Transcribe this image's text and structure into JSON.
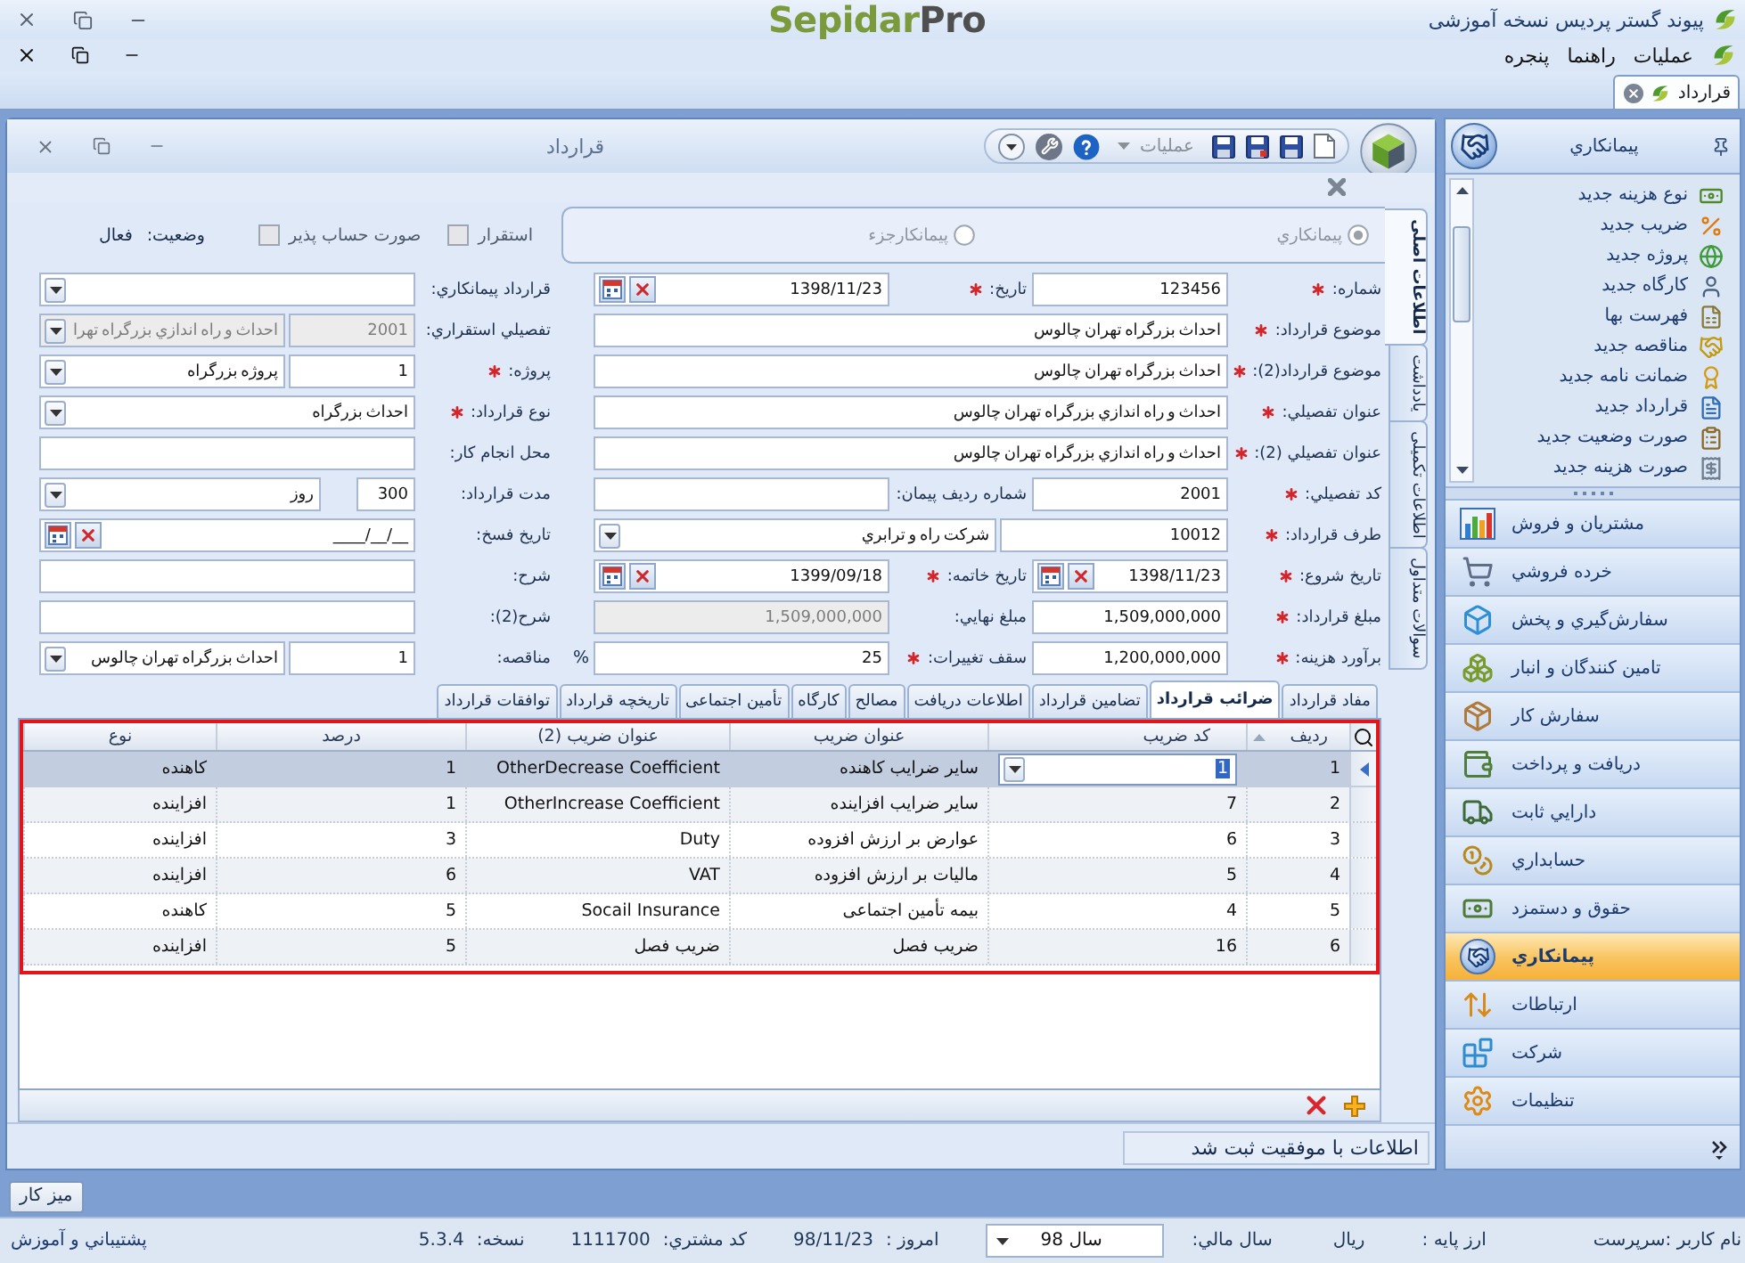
{
  "app_window": {
    "title": "پیوند گستر پردیس نسخه آموزشی",
    "logo": {
      "name": "Sepidar",
      "edition": "Pro"
    }
  },
  "menu": [
    {
      "label": "عملیات"
    },
    {
      "label": "راهنما"
    },
    {
      "label": "پنجره"
    }
  ],
  "document_tabs": [
    {
      "label": "قرارداد",
      "selected": true
    }
  ],
  "nav_panel": {
    "title": "پیمانکاري",
    "shortcuts": [
      {
        "label": "نوع هزینه جدید"
      },
      {
        "label": "ضریب جدید"
      },
      {
        "label": "پروژه جدید"
      },
      {
        "label": "کارگاه جدید"
      },
      {
        "label": "فهرست بها"
      },
      {
        "label": "مناقصه جدید"
      },
      {
        "label": "ضمانت نامه جدید"
      },
      {
        "label": "قرارداد جدید"
      },
      {
        "label": "صورت وضعیت جدید"
      },
      {
        "label": "صورت هزینه جدید"
      }
    ],
    "modules": [
      {
        "label": "مشتریان و فروش",
        "selected": false
      },
      {
        "label": "خرده فروشي",
        "selected": false
      },
      {
        "label": "سفارش‌گیري و پخش",
        "selected": false
      },
      {
        "label": "تامین کنندگان و انبار",
        "selected": false
      },
      {
        "label": "سفارش کار",
        "selected": false
      },
      {
        "label": "دریافت و پرداخت",
        "selected": false
      },
      {
        "label": "دارایي ثابت",
        "selected": false
      },
      {
        "label": "حسابداري",
        "selected": false
      },
      {
        "label": "حقوق و دستمزد",
        "selected": false
      },
      {
        "label": "پیمانکاري",
        "selected": true
      },
      {
        "label": "ارتباطات",
        "selected": false
      },
      {
        "label": "شرکت",
        "selected": false
      },
      {
        "label": "تنظیمات",
        "selected": false
      }
    ]
  },
  "document_window": {
    "title": "قرارداد",
    "operations_menu": "عملیات"
  },
  "form": {
    "side_tabs": [
      {
        "label": "اطلاعات اصلی",
        "selected": true
      },
      {
        "label": "یادداشت",
        "selected": false
      },
      {
        "label": "اطلاعات تکمیلی",
        "selected": false
      },
      {
        "label": "سوالات متداول",
        "selected": false
      }
    ],
    "contractor_type": [
      {
        "label": "پیمانکاري",
        "selected": true,
        "disabled": true
      },
      {
        "label": "پیمانکارجزء",
        "selected": false,
        "disabled": true
      }
    ],
    "options": [
      {
        "label": "استقرار",
        "checked": false,
        "disabled": true
      },
      {
        "label": "صورت حساب پذیر",
        "checked": false,
        "disabled": true
      }
    ],
    "status": {
      "label": "وضعیت:",
      "value": "فعال"
    },
    "rows": [
      [
        {
          "label": "شماره:",
          "required": true,
          "fields": [
            {
              "kind": "text",
              "value": "123456",
              "disabled": false
            }
          ]
        },
        {
          "label": "تاریخ:",
          "required": true,
          "fields": [
            {
              "kind": "date",
              "value": "1398/11/23",
              "disabled": false
            }
          ]
        },
        {
          "label": "قرارداد پیمانکاري:",
          "required": false,
          "fields": [
            {
              "kind": "combo",
              "disabled": false
            }
          ]
        }
      ],
      [
        {
          "label": "موضوع قرارداد:",
          "required": true,
          "fields": [
            {
              "kind": "text",
              "value": "احداث بزرگراه تهران چالوس",
              "disabled": false
            }
          ]
        },
        {
          "label": "تفصیلي استقراري:",
          "required": false,
          "fields": [
            {
              "kind": "code",
              "value": "2001",
              "disabled": true
            },
            {
              "kind": "combo",
              "value": "احداث و راه اندازي بزرگراه تهرا",
              "disabled": true
            }
          ]
        }
      ],
      [
        {
          "label": "موضوع قرارداد(2):",
          "required": true,
          "fields": [
            {
              "kind": "text",
              "value": "احداث بزرگراه تهران چالوس",
              "disabled": false
            }
          ]
        },
        {
          "label": "پروژه:",
          "required": true,
          "fields": [
            {
              "kind": "code",
              "value": "1",
              "disabled": false
            },
            {
              "kind": "combo",
              "value": "پروژه بزرگراه",
              "disabled": false
            }
          ]
        }
      ],
      [
        {
          "label": "عنوان تفصیلي:",
          "required": true,
          "fields": [
            {
              "kind": "text",
              "value": "احداث و راه اندازي بزرگراه تهران چالوس",
              "disabled": false
            }
          ]
        },
        {
          "label": "نوع قرارداد:",
          "required": true,
          "fields": [
            {
              "kind": "combo",
              "value": "احداث بزرگراه",
              "disabled": false
            }
          ]
        }
      ],
      [
        {
          "label": "عنوان تفصیلي (2):",
          "required": true,
          "fields": [
            {
              "kind": "text",
              "value": "احداث و راه اندازي بزرگراه تهران چالوس",
              "disabled": false
            }
          ]
        },
        {
          "label": "محل انجام کار:",
          "required": false,
          "fields": [
            {
              "kind": "text",
              "disabled": false
            }
          ]
        }
      ],
      [
        {
          "label": "کد تفصیلي:",
          "required": true,
          "fields": [
            {
              "kind": "text",
              "value": "2001",
              "disabled": false
            }
          ]
        },
        {
          "label": "شماره ردیف پیمان:",
          "required": false,
          "fields": [
            {
              "kind": "text",
              "disabled": false
            }
          ]
        },
        {
          "label": "مدت قرارداد:",
          "required": false,
          "fields": [
            {
              "kind": "short",
              "value": "300",
              "disabled": false
            },
            {
              "kind": "combo",
              "value": "روز",
              "disabled": false
            }
          ]
        }
      ],
      [
        {
          "label": "طرف قرارداد:",
          "required": true,
          "fields": [
            {
              "kind": "code",
              "value": "10012",
              "disabled": false
            },
            {
              "kind": "combo",
              "value": "شرکت راه و ترابري",
              "disabled": false
            }
          ]
        },
        {
          "label": "تاریخ فسخ:",
          "required": false,
          "fields": [
            {
              "kind": "date",
              "value": "____/__/__",
              "disabled": false
            }
          ]
        }
      ],
      [
        {
          "label": "تاریخ شروع:",
          "required": true,
          "fields": [
            {
              "kind": "date",
              "value": "1398/11/23",
              "disabled": false
            }
          ]
        },
        {
          "label": "تاریخ خاتمه:",
          "required": true,
          "fields": [
            {
              "kind": "date",
              "value": "1399/09/18",
              "disabled": false
            }
          ]
        },
        {
          "label": "شرح:",
          "required": false,
          "fields": [
            {
              "kind": "text",
              "disabled": false
            }
          ]
        }
      ],
      [
        {
          "label": "مبلغ قرارداد:",
          "required": true,
          "fields": [
            {
              "kind": "text",
              "value": "1,509,000,000",
              "disabled": false
            }
          ]
        },
        {
          "label": "مبلغ نهایي:",
          "required": false,
          "fields": [
            {
              "kind": "text",
              "value": "1,509,000,000",
              "disabled": true
            }
          ]
        },
        {
          "label": "شرح(2):",
          "required": false,
          "fields": [
            {
              "kind": "text",
              "disabled": false
            }
          ]
        }
      ],
      [
        {
          "label": "برآورد هزینه:",
          "required": true,
          "fields": [
            {
              "kind": "text",
              "value": "1,200,000,000",
              "disabled": false
            }
          ]
        },
        {
          "label": "سقف تغییرات:",
          "required": true,
          "suffix": "%",
          "fields": [
            {
              "kind": "text",
              "value": "25",
              "disabled": false
            }
          ]
        },
        {
          "label": "مناقصه:",
          "required": false,
          "fields": [
            {
              "kind": "code",
              "value": "1",
              "disabled": false
            },
            {
              "kind": "combo",
              "value": "احداث بزرگراه تهران چالوس",
              "disabled": false
            }
          ]
        }
      ]
    ]
  },
  "detail_tabs": [
    {
      "label": "مفاد قرارداد",
      "selected": false
    },
    {
      "label": "ضرائب قرارداد",
      "selected": true
    },
    {
      "label": "تضامین قرارداد",
      "selected": false
    },
    {
      "label": "اطلاعات دریافت",
      "selected": false
    },
    {
      "label": "مصالح",
      "selected": false
    },
    {
      "label": "کارگاه",
      "selected": false
    },
    {
      "label": "تأمین اجتماعی",
      "selected": false
    },
    {
      "label": "تاریخچه قرارداد",
      "selected": false
    },
    {
      "label": "توافقات قرارداد",
      "selected": false
    }
  ],
  "table": {
    "columns": [
      {
        "label": "ردیف",
        "sorted": true
      },
      {
        "label": "کد ضریب",
        "sorted": false
      },
      {
        "label": "عنوان ضریب",
        "sorted": false
      },
      {
        "label": "عنوان ضریب (2)",
        "sorted": false
      },
      {
        "label": "درصد",
        "sorted": false
      },
      {
        "label": "نوع",
        "sorted": false
      }
    ],
    "rows": [
      {
        "cells": [
          "1",
          "1",
          "سایر ضرایب کاهنده",
          "OtherDecrease Coefficient",
          "1",
          "کاهنده"
        ],
        "selected": true,
        "editing": true
      },
      {
        "cells": [
          "2",
          "7",
          "سایر ضرایب افزاینده",
          "OtherIncrease Coefficient",
          "1",
          "افزاینده"
        ],
        "selected": false,
        "editing": false
      },
      {
        "cells": [
          "3",
          "6",
          "عوارض بر ارزش افزوده",
          "Duty",
          "3",
          "افزاینده"
        ],
        "selected": false,
        "editing": false
      },
      {
        "cells": [
          "4",
          "5",
          "مالیات بر ارزش افزوده",
          "VAT",
          "6",
          "افزاینده"
        ],
        "selected": false,
        "editing": false
      },
      {
        "cells": [
          "5",
          "4",
          "بیمه تأمین اجتماعی",
          "Socail Insurance",
          "5",
          "کاهنده"
        ],
        "selected": false,
        "editing": false
      },
      {
        "cells": [
          "6",
          "16",
          "ضریب فصل",
          "ضریب فصل",
          "5",
          "افزاینده"
        ],
        "selected": false,
        "editing": false
      }
    ]
  },
  "status_message": "اطلاعات با موفقیت ثبت شد",
  "taskbar": [
    {
      "label": "میز کار"
    }
  ],
  "status_bar": {
    "user": "نام کاربر :سرپرست",
    "currency": {
      "label": "ارز پایه :",
      "value": "ریال"
    },
    "fiscal_year": {
      "label": "سال مالي:",
      "value": "سال 98"
    },
    "items": [
      {
        "label": "امروز :",
        "value": "98/11/23"
      },
      {
        "label": "کد مشتري:",
        "value": "1111700"
      },
      {
        "label": "نسخه:",
        "value": "5.3.4"
      }
    ],
    "support_link": "پشتیباني و آموزش"
  }
}
